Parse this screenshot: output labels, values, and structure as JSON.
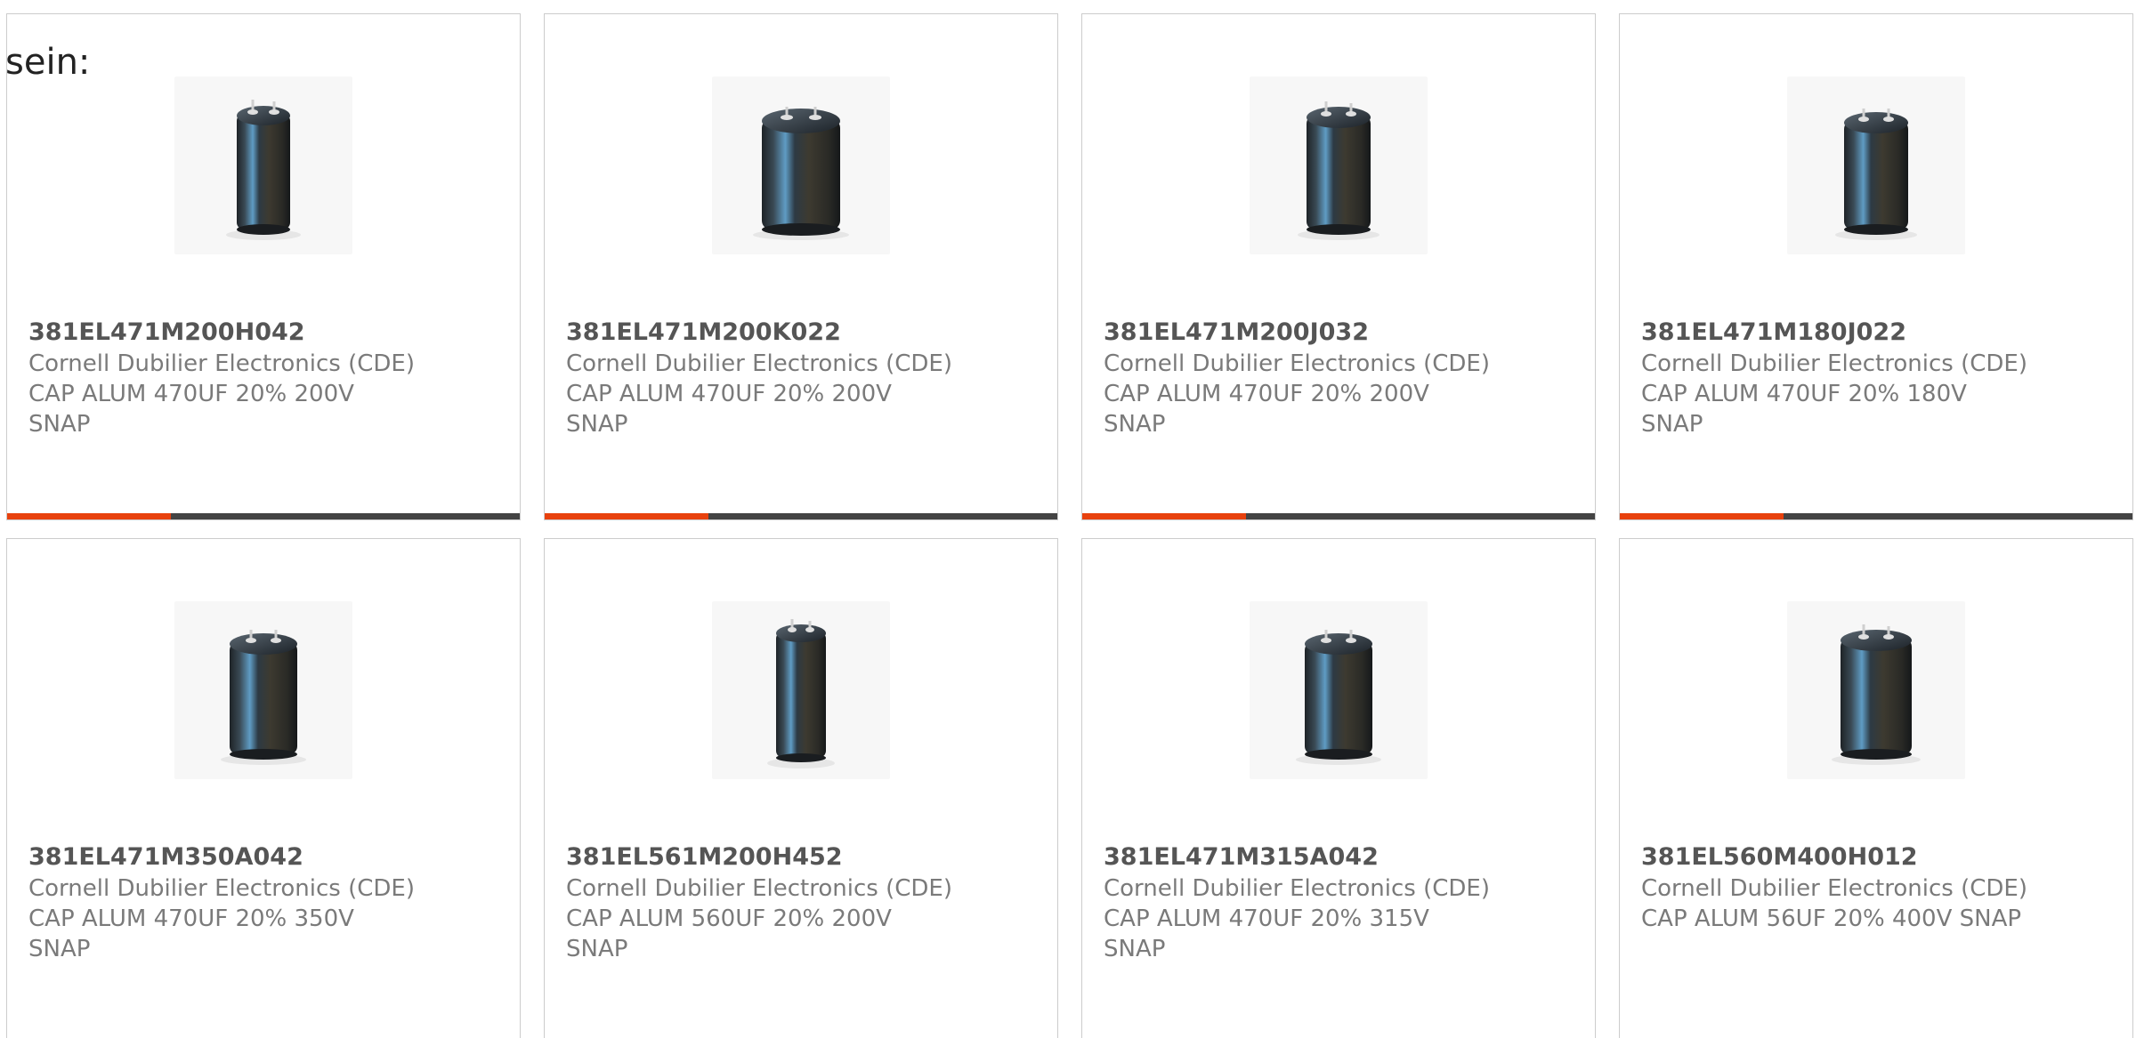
{
  "lead_text": "sein:",
  "accent_color": "#e8410d",
  "track_color": "#444444",
  "products": [
    {
      "part_number": "381EL471M200H042",
      "manufacturer": "Cornell Dubilier Electronics (CDE)",
      "description": "CAP ALUM 470UF 20% 200V SNAP",
      "icon": "capacitor-image",
      "progress": 0.32
    },
    {
      "part_number": "381EL471M200K022",
      "manufacturer": "Cornell Dubilier Electronics (CDE)",
      "description": "CAP ALUM 470UF 20% 200V SNAP",
      "icon": "capacitor-image",
      "progress": 0.32
    },
    {
      "part_number": "381EL471M200J032",
      "manufacturer": "Cornell Dubilier Electronics (CDE)",
      "description": "CAP ALUM 470UF 20% 200V SNAP",
      "icon": "capacitor-image",
      "progress": 0.32
    },
    {
      "part_number": "381EL471M180J022",
      "manufacturer": "Cornell Dubilier Electronics (CDE)",
      "description": "CAP ALUM 470UF 20% 180V SNAP",
      "icon": "capacitor-image",
      "progress": 0.32
    },
    {
      "part_number": "381EL471M350A042",
      "manufacturer": "Cornell Dubilier Electronics (CDE)",
      "description": "CAP ALUM 470UF 20% 350V SNAP",
      "icon": "capacitor-image"
    },
    {
      "part_number": "381EL561M200H452",
      "manufacturer": "Cornell Dubilier Electronics (CDE)",
      "description": "CAP ALUM 560UF 20% 200V SNAP",
      "icon": "capacitor-image"
    },
    {
      "part_number": "381EL471M315A042",
      "manufacturer": "Cornell Dubilier Electronics (CDE)",
      "description": "CAP ALUM 470UF 20% 315V SNAP",
      "icon": "capacitor-image"
    },
    {
      "part_number": "381EL560M400H012",
      "manufacturer": "Cornell Dubilier Electronics (CDE)",
      "description": "CAP ALUM 56UF 20% 400V SNAP",
      "icon": "capacitor-image"
    }
  ]
}
